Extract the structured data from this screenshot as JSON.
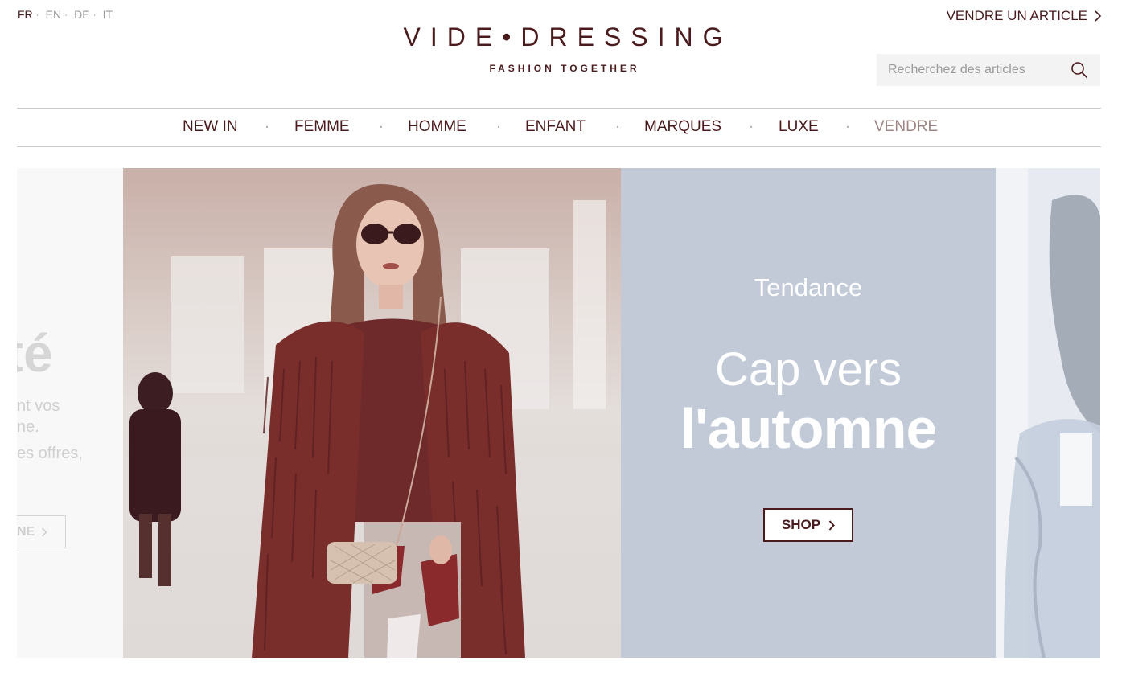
{
  "languages": [
    {
      "code": "FR",
      "active": true
    },
    {
      "code": "EN",
      "active": false
    },
    {
      "code": "DE",
      "active": false
    },
    {
      "code": "IT",
      "active": false
    }
  ],
  "brand": {
    "logo": "VIDE•DRESSING",
    "tagline": "FASHION TOGETHER"
  },
  "header": {
    "sell_label": "VENDRE UN ARTICLE",
    "search_placeholder": "Recherchez des articles"
  },
  "nav": {
    "items": [
      "NEW IN",
      "FEMME",
      "HOMME",
      "ENFANT",
      "MARQUES",
      "LUXE",
      "VENDRE"
    ]
  },
  "carousel": {
    "prev_slide": {
      "title_fragment": "té",
      "text_lines": [
        "nt vos",
        "ne.",
        "es offres,"
      ],
      "button_fragment": "NE"
    },
    "active_slide": {
      "kicker": "Tendance",
      "title_line1": "Cap vers",
      "title_line2": "l'automne",
      "button_label": "SHOP"
    }
  },
  "colors": {
    "brand": "#4a1a1c",
    "muted_text": "#9a9a9a",
    "hero_panel": "#c2cad8",
    "coat": "#7a2e2c"
  }
}
